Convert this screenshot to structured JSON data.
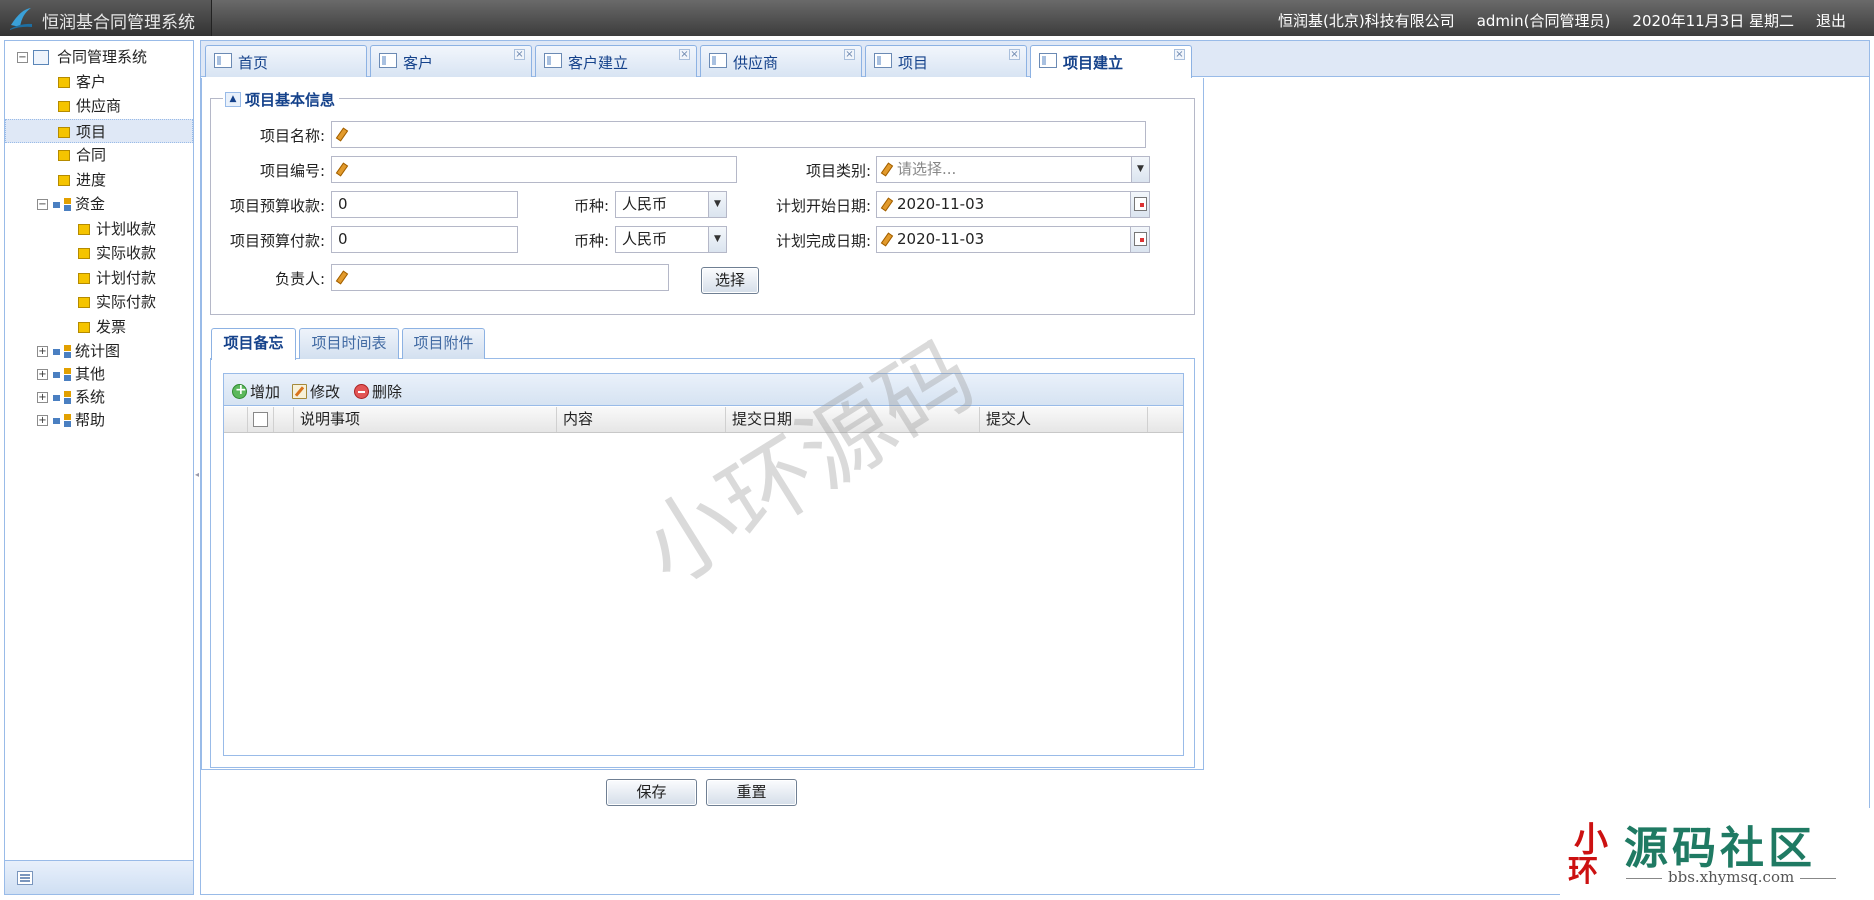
{
  "header": {
    "app_title": "恒润基合同管理系统",
    "company": "恒润基(北京)科技有限公司",
    "user": "admin(合同管理员)",
    "date": "2020年11月3日 星期二",
    "logout": "退出"
  },
  "sidebar": {
    "root": "合同管理系统",
    "items": [
      {
        "label": "客户"
      },
      {
        "label": "供应商"
      },
      {
        "label": "项目",
        "selected": true
      },
      {
        "label": "合同"
      },
      {
        "label": "进度"
      }
    ],
    "funds": {
      "label": "资金",
      "children": [
        {
          "label": "计划收款"
        },
        {
          "label": "实际收款"
        },
        {
          "label": "计划付款"
        },
        {
          "label": "实际付款"
        },
        {
          "label": "发票"
        }
      ]
    },
    "groups": [
      {
        "label": "统计图"
      },
      {
        "label": "其他"
      },
      {
        "label": "系统"
      },
      {
        "label": "帮助"
      }
    ]
  },
  "tabs": [
    {
      "label": "首页",
      "closable": false
    },
    {
      "label": "客户",
      "closable": true
    },
    {
      "label": "客户建立",
      "closable": true
    },
    {
      "label": "供应商",
      "closable": true
    },
    {
      "label": "项目",
      "closable": true
    },
    {
      "label": "项目建立",
      "closable": true,
      "active": true
    }
  ],
  "form": {
    "legend": "项目基本信息",
    "name_label": "项目名称:",
    "name_value": "",
    "code_label": "项目编号:",
    "code_value": "",
    "category_label": "项目类别:",
    "category_placeholder": "请选择...",
    "budget_in_label": "项目预算收款:",
    "budget_in_value": "0",
    "currency_label": "币种:",
    "currency_in_value": "人民币",
    "start_label": "计划开始日期:",
    "start_value": "2020-11-03",
    "budget_out_label": "项目预算付款:",
    "budget_out_value": "0",
    "currency_out_value": "人民币",
    "end_label": "计划完成日期:",
    "end_value": "2020-11-03",
    "owner_label": "负责人:",
    "owner_value": "",
    "select_button": "选择"
  },
  "inner_tabs": [
    {
      "label": "项目备忘",
      "active": true
    },
    {
      "label": "项目时间表"
    },
    {
      "label": "项目附件"
    }
  ],
  "grid": {
    "toolbar": {
      "add": "增加",
      "edit": "修改",
      "delete": "删除"
    },
    "columns": [
      "说明事项",
      "内容",
      "提交日期",
      "提交人"
    ],
    "rows": []
  },
  "actions": {
    "save": "保存",
    "reset": "重置"
  },
  "watermark": {
    "text": "小环源码",
    "badge_seal_a": "小",
    "badge_seal_b": "环",
    "badge_title": "源码社区",
    "badge_url": "bbs.xhymsq.com"
  }
}
